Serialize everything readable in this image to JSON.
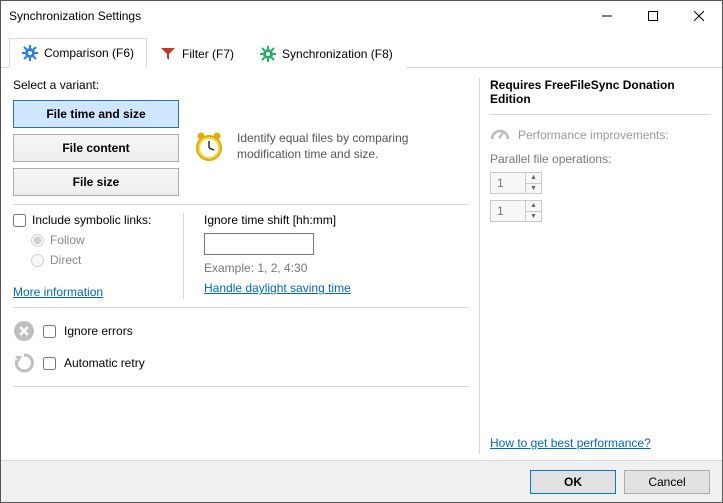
{
  "window": {
    "title": "Synchronization Settings"
  },
  "tabs": {
    "comparison": "Comparison (F6)",
    "filter": "Filter (F7)",
    "synchronization": "Synchronization (F8)"
  },
  "variant": {
    "label": "Select a variant:",
    "time_size": "File time and size",
    "content": "File content",
    "size": "File size"
  },
  "description": "Identify equal files by comparing modification time and size.",
  "symlinks": {
    "label": "Include symbolic links:",
    "follow": "Follow",
    "direct": "Direct",
    "more_info": "More information"
  },
  "timeshift": {
    "label": "Ignore time shift [hh:mm]",
    "example": "Example:  1, 2, 4:30",
    "dst_link": "Handle daylight saving time"
  },
  "errors": {
    "ignore": "Ignore errors",
    "retry": "Automatic retry"
  },
  "right": {
    "header": "Requires FreeFileSync Donation Edition",
    "perf": "Performance improvements:",
    "parallel": "Parallel file operations:",
    "spin1": "1",
    "spin2": "1",
    "perf_link": "How to get best performance?"
  },
  "footer": {
    "ok": "OK",
    "cancel": "Cancel"
  }
}
